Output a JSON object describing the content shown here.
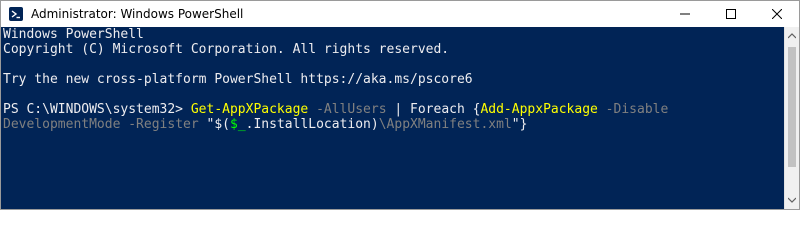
{
  "window": {
    "title": "Administrator: Windows PowerShell",
    "controls": {
      "minimize_icon": "minimize-icon",
      "maximize_icon": "maximize-icon",
      "close_icon": "close-icon"
    }
  },
  "console": {
    "background": "#012456",
    "lines": [
      {
        "text": "Windows PowerShell"
      },
      {
        "text": "Copyright (C) Microsoft Corporation. All rights reserved."
      },
      {
        "text": "Try the new cross-platform PowerShell https://aka.ms/pscore6"
      }
    ],
    "command": {
      "prompt": "PS C:\\WINDOWS\\system32> ",
      "cmdlet1": "Get-AppXPackage",
      "param1": " -AllUsers",
      "pipe_foreach": " | Foreach {",
      "cmdlet2": "Add-AppxPackage",
      "param2": " -Disable",
      "param2_cont": "DevelopmentMode",
      "param3": " -Register",
      "str_open": " \"$(",
      "var": "$_",
      "member": ".InstallLocation)",
      "path": "\\AppXManifest.xml",
      "str_close": "\"}"
    }
  },
  "colors": {
    "cmdlet": "#ffff00",
    "parameter": "#808080",
    "text": "#eeedf0",
    "variable": "#00ff00"
  }
}
